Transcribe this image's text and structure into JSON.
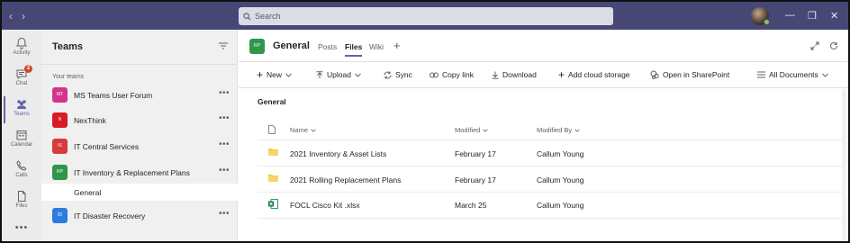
{
  "titlebar": {
    "search_placeholder": "Search"
  },
  "appbar": {
    "items": [
      {
        "label": "Activity"
      },
      {
        "label": "Chat",
        "badge": "2"
      },
      {
        "label": "Teams"
      },
      {
        "label": "Calendar"
      },
      {
        "label": "Calls"
      },
      {
        "label": "Files"
      }
    ],
    "more": "•••"
  },
  "teams_pane": {
    "title": "Teams",
    "section": "Your teams",
    "teams": [
      {
        "initials": "MT",
        "name": "MS Teams User Forum",
        "color": "#d6348c"
      },
      {
        "initials": "N",
        "name": "NexThink",
        "color": "#d81b28"
      },
      {
        "initials": "IS",
        "name": "IT Central Services",
        "color": "#d83b3b"
      },
      {
        "initials": "RP",
        "name": "IT Inventory & Replacement Plans",
        "color": "#30964a"
      },
      {
        "initials": "ID",
        "name": "IT Disaster Recovery",
        "color": "#2c7ce0"
      }
    ],
    "active_channel": "General",
    "more": "•••"
  },
  "header": {
    "initials": "RP",
    "channel": "General",
    "tabs": [
      "Posts",
      "Files",
      "Wiki"
    ],
    "active_tab": "Files",
    "add_tab": "+"
  },
  "toolbar": {
    "new": "New",
    "upload": "Upload",
    "sync": "Sync",
    "copy_link": "Copy link",
    "download": "Download",
    "add_cloud": "Add cloud storage",
    "open_sharepoint": "Open in SharePoint",
    "view": "All Documents"
  },
  "files": {
    "folder": "General",
    "columns": {
      "name": "Name",
      "modified": "Modified",
      "modified_by": "Modified By"
    },
    "rows": [
      {
        "type": "folder",
        "name": "2021 Inventory & Asset Lists",
        "modified": "February 17",
        "modified_by": "Callum Young"
      },
      {
        "type": "folder",
        "name": "2021 Rolling Replacement Plans",
        "modified": "February 17",
        "modified_by": "Callum Young"
      },
      {
        "type": "excel",
        "name": "FOCL Cisco Kit .xlsx",
        "modified": "March 25",
        "modified_by": "Callum Young"
      }
    ]
  }
}
